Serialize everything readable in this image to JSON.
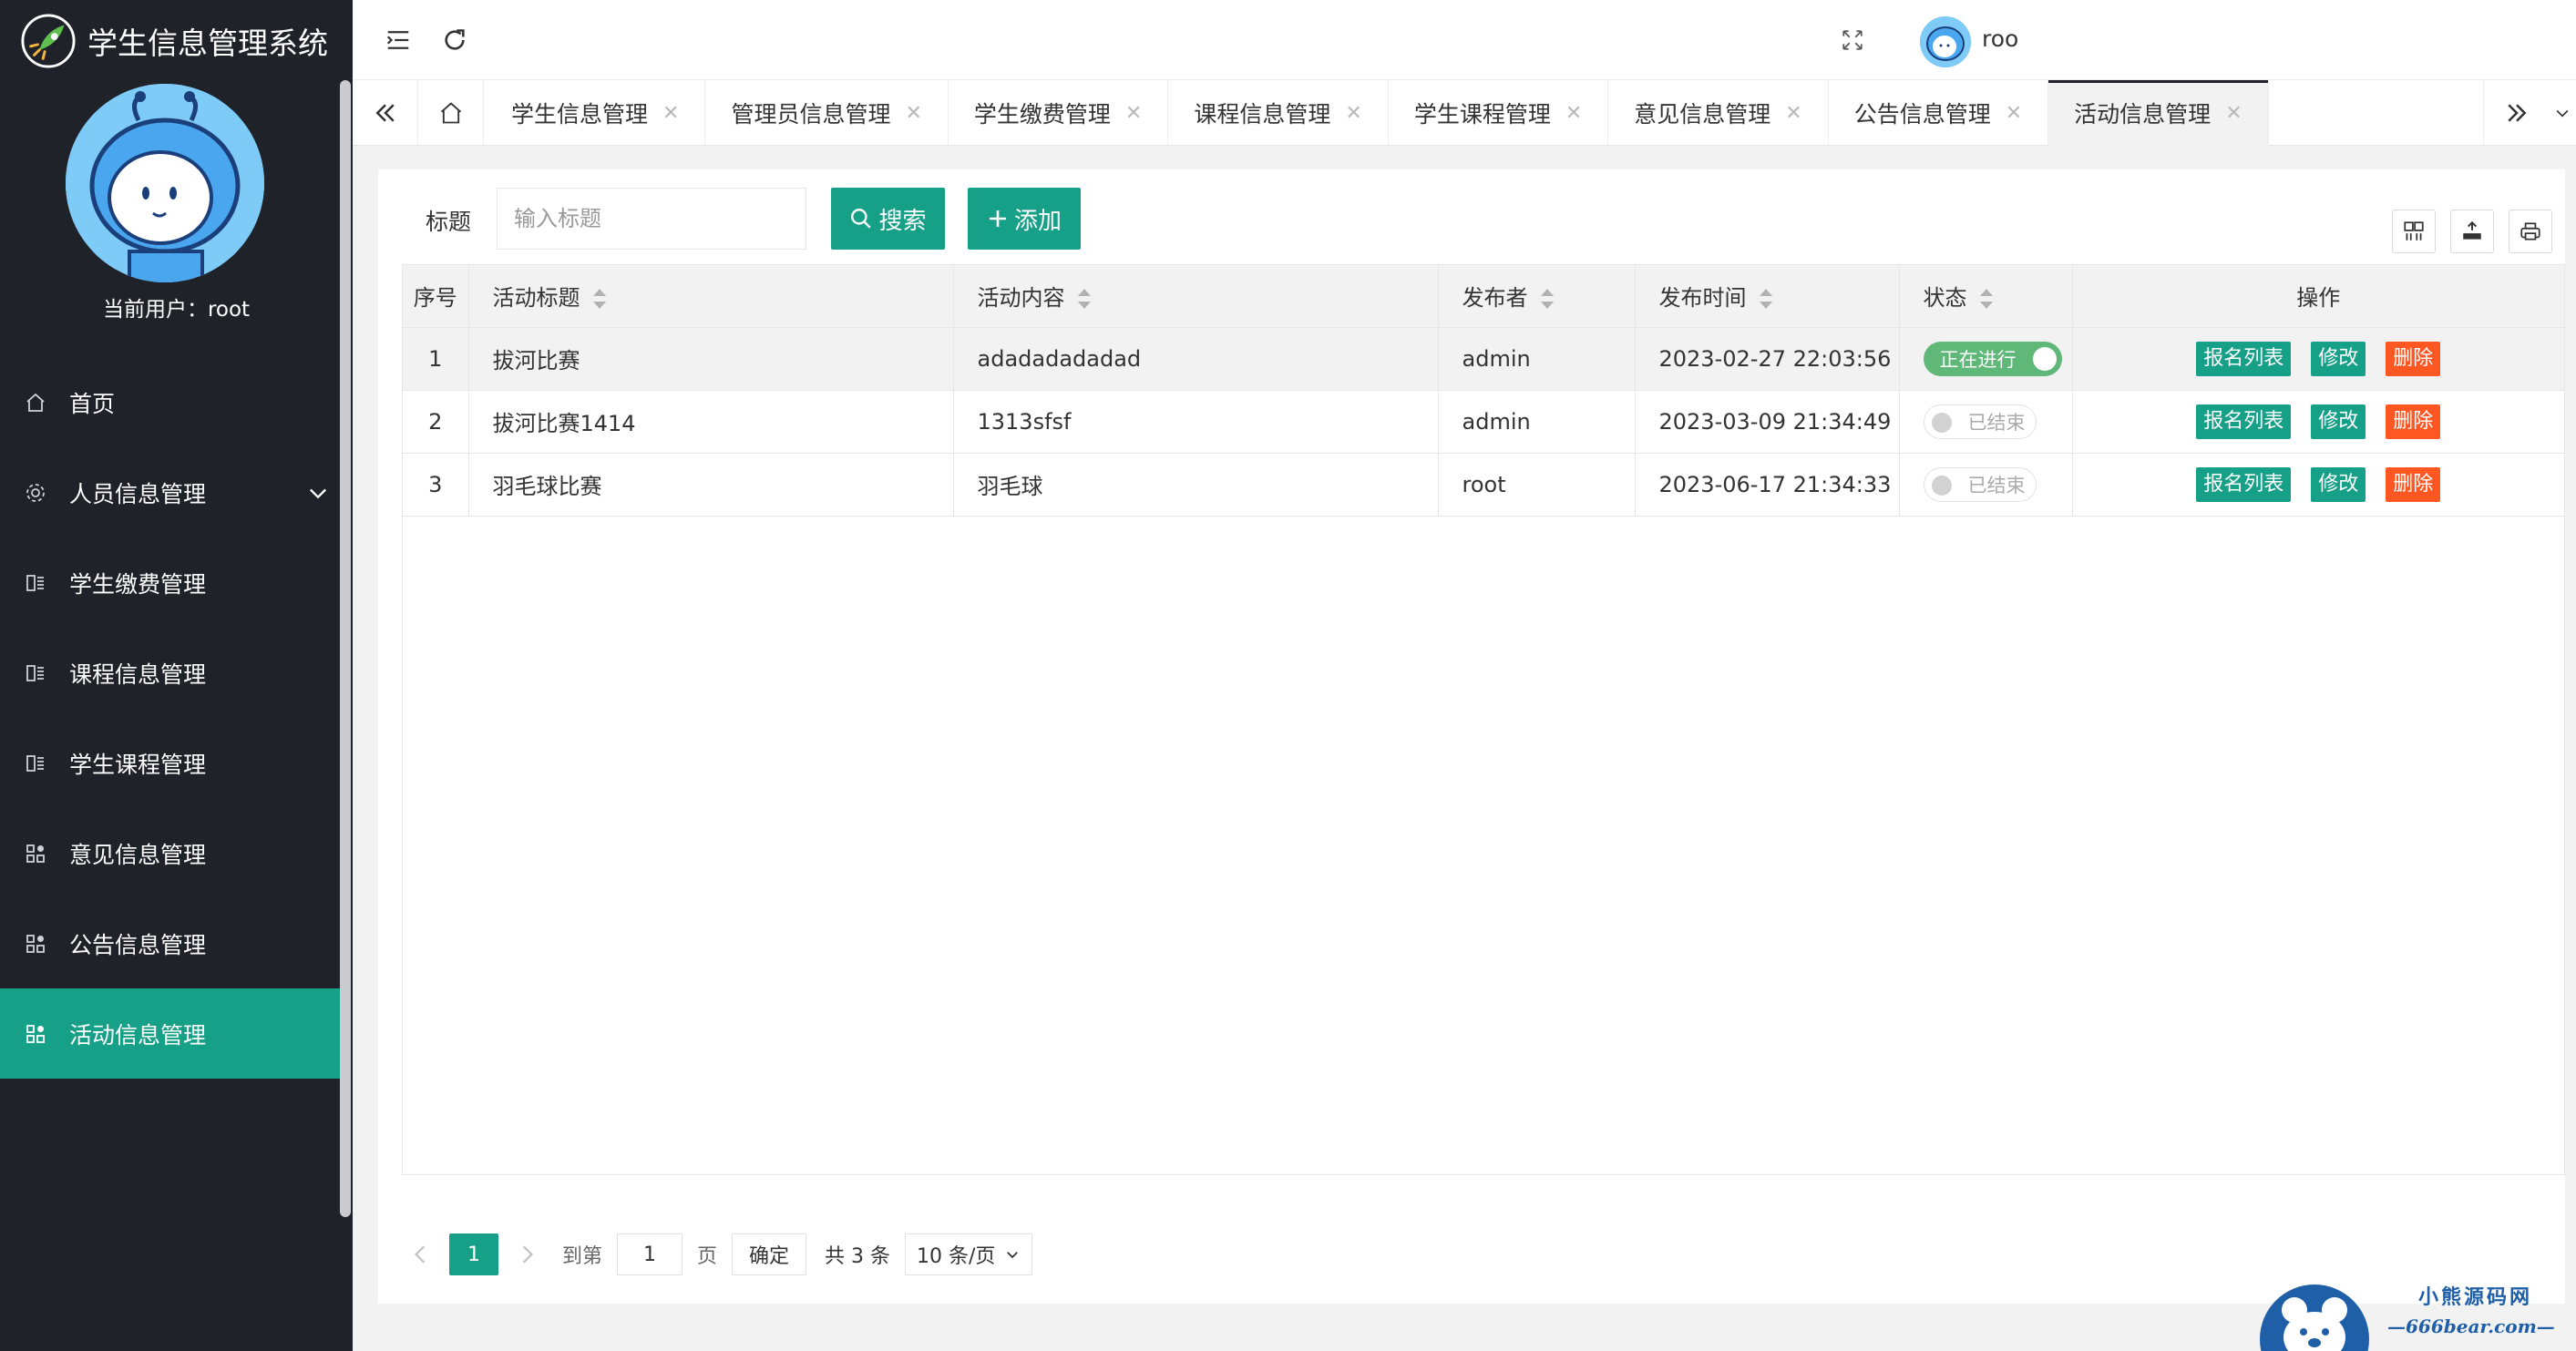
{
  "app": {
    "title": "学生信息管理系统",
    "current_user_label": "当前用户：root"
  },
  "sidebar": {
    "items": [
      {
        "label": "首页",
        "icon": "home-icon"
      },
      {
        "label": "人员信息管理",
        "icon": "gear-icon",
        "expandable": true
      },
      {
        "label": "学生缴费管理",
        "icon": "book-icon"
      },
      {
        "label": "课程信息管理",
        "icon": "book-icon"
      },
      {
        "label": "学生课程管理",
        "icon": "book-icon"
      },
      {
        "label": "意见信息管理",
        "icon": "apps-icon"
      },
      {
        "label": "公告信息管理",
        "icon": "apps-icon"
      },
      {
        "label": "活动信息管理",
        "icon": "apps-icon",
        "active": true
      }
    ]
  },
  "header": {
    "user_name": "roo"
  },
  "tabs": [
    {
      "label": "学生信息管理"
    },
    {
      "label": "管理员信息管理"
    },
    {
      "label": "学生缴费管理"
    },
    {
      "label": "课程信息管理"
    },
    {
      "label": "学生课程管理"
    },
    {
      "label": "意见信息管理"
    },
    {
      "label": "公告信息管理"
    },
    {
      "label": "活动信息管理",
      "active": true
    }
  ],
  "search": {
    "label": "标题",
    "placeholder": "输入标题",
    "search_button": "搜索",
    "add_button": "添加"
  },
  "table": {
    "columns": [
      "序号",
      "活动标题",
      "活动内容",
      "发布者",
      "发布时间",
      "状态",
      "操作"
    ],
    "rows": [
      {
        "idx": "1",
        "title": "拔河比赛",
        "content": "adadadadadad",
        "publisher": "admin",
        "time": "2023-02-27 22:03:56",
        "status": "正在进行",
        "status_on": true
      },
      {
        "idx": "2",
        "title": "拔河比赛1414",
        "content": "1313sfsf",
        "publisher": "admin",
        "time": "2023-03-09 21:34:49",
        "status": "已结束",
        "status_on": false
      },
      {
        "idx": "3",
        "title": "羽毛球比赛",
        "content": "羽毛球",
        "publisher": "root",
        "time": "2023-06-17 21:34:33",
        "status": "已结束",
        "status_on": false
      }
    ],
    "actions": {
      "signup_list": "报名列表",
      "edit": "修改",
      "delete": "删除"
    }
  },
  "pagination": {
    "current_page": "1",
    "goto_label": "到第",
    "goto_value": "1",
    "page_unit": "页",
    "confirm": "确定",
    "total": "共 3 条",
    "page_size": "10 条/页"
  },
  "watermark": {
    "line1": "小熊源码网",
    "line2": "—666bear.com—"
  },
  "colors": {
    "sidebar_bg": "#20222a",
    "accent": "#16a088",
    "danger": "#ff5722",
    "switch_on": "#5fb878"
  }
}
